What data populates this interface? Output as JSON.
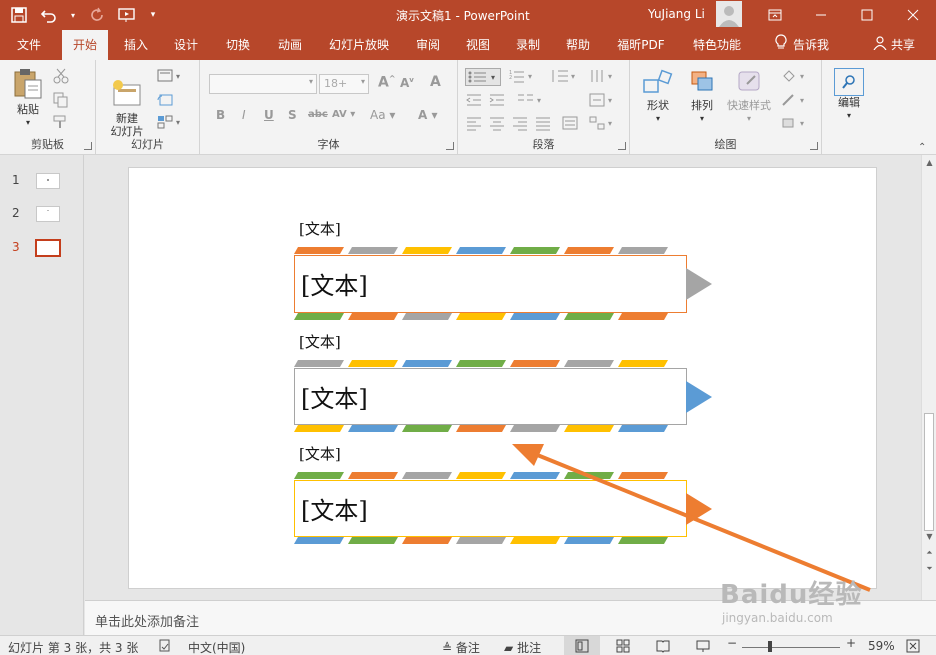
{
  "app": {
    "title": "演示文稿1  -  PowerPoint",
    "user": "YuJiang Li"
  },
  "menu": {
    "tabs": [
      "文件",
      "开始",
      "插入",
      "设计",
      "切换",
      "动画",
      "幻灯片放映",
      "审阅",
      "视图",
      "录制",
      "帮助",
      "福昕PDF",
      "特色功能",
      "告诉我"
    ],
    "active": "开始",
    "share": "共享"
  },
  "ribbon": {
    "clipboard": {
      "paste": "粘贴",
      "label": "剪贴板"
    },
    "slides": {
      "new_slide": "新建\n幻灯片",
      "label": "幻灯片"
    },
    "font": {
      "font_name": "",
      "font_size": "18+",
      "label": "字体",
      "bold": "B",
      "italic": "I",
      "underline": "U",
      "shadow": "S",
      "strike": "abc",
      "spacing": "AV",
      "case": "Aa",
      "color": "A"
    },
    "paragraph": {
      "label": "段落"
    },
    "drawing": {
      "shapes": "形状",
      "arrange": "排列",
      "quick_styles": "快速样式",
      "label": "绘图"
    },
    "editing": {
      "edit": "编辑"
    }
  },
  "slides_panel": {
    "items": [
      {
        "num": "1",
        "active": false
      },
      {
        "num": "2",
        "active": false
      },
      {
        "num": "3",
        "active": true
      }
    ]
  },
  "slide": {
    "blocks": [
      {
        "label": "[文本]",
        "text": "[文本]",
        "border_color": "#ed7d31",
        "arrow_color": "#a5a5a5"
      },
      {
        "label": "[文本]",
        "text": "[文本]",
        "border_color": "#a5a5a5",
        "arrow_color": "#5b9bd5"
      },
      {
        "label": "[文本]",
        "text": "[文本]",
        "border_color": "#ffc000",
        "arrow_color": "#ed7d31"
      }
    ],
    "band_colors": [
      "#ed7d31",
      "#a5a5a5",
      "#ffc000",
      "#5b9bd5",
      "#70ad47"
    ]
  },
  "notes": {
    "placeholder": "单击此处添加备注"
  },
  "status": {
    "slide_info": "幻灯片 第 3 张，共 3 张",
    "language": "中文(中国)",
    "notes_btn": "备注",
    "comments_btn": "批注",
    "zoom": "59%",
    "zoom_value": 0.59
  },
  "watermark": {
    "brand": "Baidu经验",
    "url": "jingyan.baidu.com"
  },
  "colors": {
    "accent": "#b7472a",
    "arrow_annotation": "#ed7d31"
  }
}
